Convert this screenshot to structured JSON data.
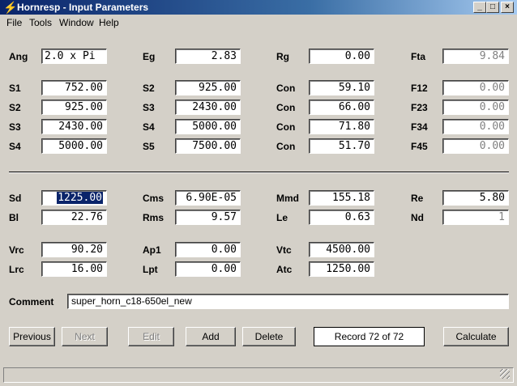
{
  "window": {
    "title": "Hornresp - Input Parameters",
    "controls": {
      "minimize": "_",
      "maximize": "□",
      "close": "×"
    }
  },
  "menu": [
    "File",
    "Tools",
    "Window",
    "Help"
  ],
  "top": {
    "ang": {
      "label": "Ang",
      "value": "2.0 x Pi"
    },
    "eg": {
      "label": "Eg",
      "value": "2.83"
    },
    "rg": {
      "label": "Rg",
      "value": "0.00"
    },
    "fta": {
      "label": "Fta",
      "value": "9.84"
    }
  },
  "horn_rows": [
    {
      "s_label": "S1",
      "s_value": "752.00",
      "s2_label": "S2",
      "s2_value": "925.00",
      "con_label": "Con",
      "con_value": "59.10",
      "f_label": "F12",
      "f_value": "0.00"
    },
    {
      "s_label": "S2",
      "s_value": "925.00",
      "s2_label": "S3",
      "s2_value": "2430.00",
      "con_label": "Con",
      "con_value": "66.00",
      "f_label": "F23",
      "f_value": "0.00"
    },
    {
      "s_label": "S3",
      "s_value": "2430.00",
      "s2_label": "S4",
      "s2_value": "5000.00",
      "con_label": "Con",
      "con_value": "71.80",
      "f_label": "F34",
      "f_value": "0.00"
    },
    {
      "s_label": "S4",
      "s_value": "5000.00",
      "s2_label": "S5",
      "s2_value": "7500.00",
      "con_label": "Con",
      "con_value": "51.70",
      "f_label": "F45",
      "f_value": "0.00"
    }
  ],
  "driver": {
    "sd": {
      "label": "Sd",
      "value": "1225.00"
    },
    "cms": {
      "label": "Cms",
      "value": "6.90E-05"
    },
    "mmd": {
      "label": "Mmd",
      "value": "155.18"
    },
    "re": {
      "label": "Re",
      "value": "5.80"
    },
    "bl": {
      "label": "Bl",
      "value": "22.76"
    },
    "rms": {
      "label": "Rms",
      "value": "9.57"
    },
    "le": {
      "label": "Le",
      "value": "0.63"
    },
    "nd": {
      "label": "Nd",
      "value": "1"
    }
  },
  "chambers": {
    "vrc": {
      "label": "Vrc",
      "value": "90.20"
    },
    "ap1": {
      "label": "Ap1",
      "value": "0.00"
    },
    "vtc": {
      "label": "Vtc",
      "value": "4500.00"
    },
    "lrc": {
      "label": "Lrc",
      "value": "16.00"
    },
    "lpt": {
      "label": "Lpt",
      "value": "0.00"
    },
    "atc": {
      "label": "Atc",
      "value": "1250.00"
    }
  },
  "comment": {
    "label": "Comment",
    "value": "super_horn_c18-650el_new"
  },
  "buttons": {
    "previous": "Previous",
    "next": "Next",
    "edit": "Edit",
    "add": "Add",
    "delete": "Delete",
    "calculate": "Calculate"
  },
  "record": "Record 72 of 72"
}
